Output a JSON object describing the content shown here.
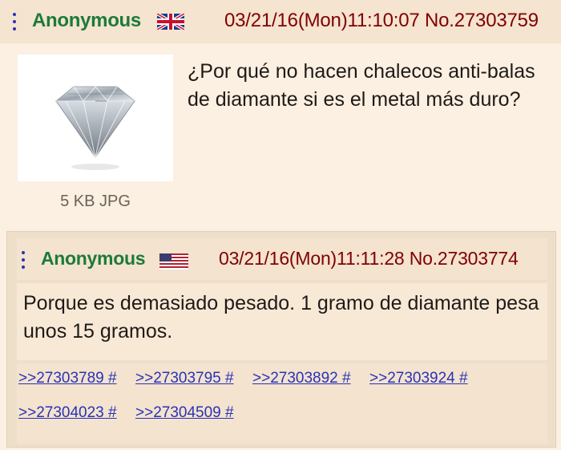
{
  "op": {
    "name": "Anonymous",
    "flag_icon": "uk-flag-icon",
    "meta": "03/21/16(Mon)11:10:07 No.27303759",
    "file_info": "5 KB JPG",
    "thumbnail_icon": "diamond-image",
    "comment": "¿Por qué no hacen chalecos anti-balas de diamante si es el metal más duro?"
  },
  "reply": {
    "name": "Anonymous",
    "flag_icon": "us-flag-icon",
    "meta": "03/21/16(Mon)11:11:28 No.27303774",
    "comment": "Porque es demasiado pesado. 1 gramo de diamante pesa unos 15 gramos.",
    "backlinks": [
      ">>27303789 #",
      ">>27303795 #",
      ">>27303892 #",
      ">>27303924 #",
      ">>27304023 #",
      ">>27304509 #"
    ]
  },
  "colors": {
    "name": "#1d7a3a",
    "meta": "#800000",
    "link": "#2a32b5",
    "background": "#fbf0e1"
  }
}
